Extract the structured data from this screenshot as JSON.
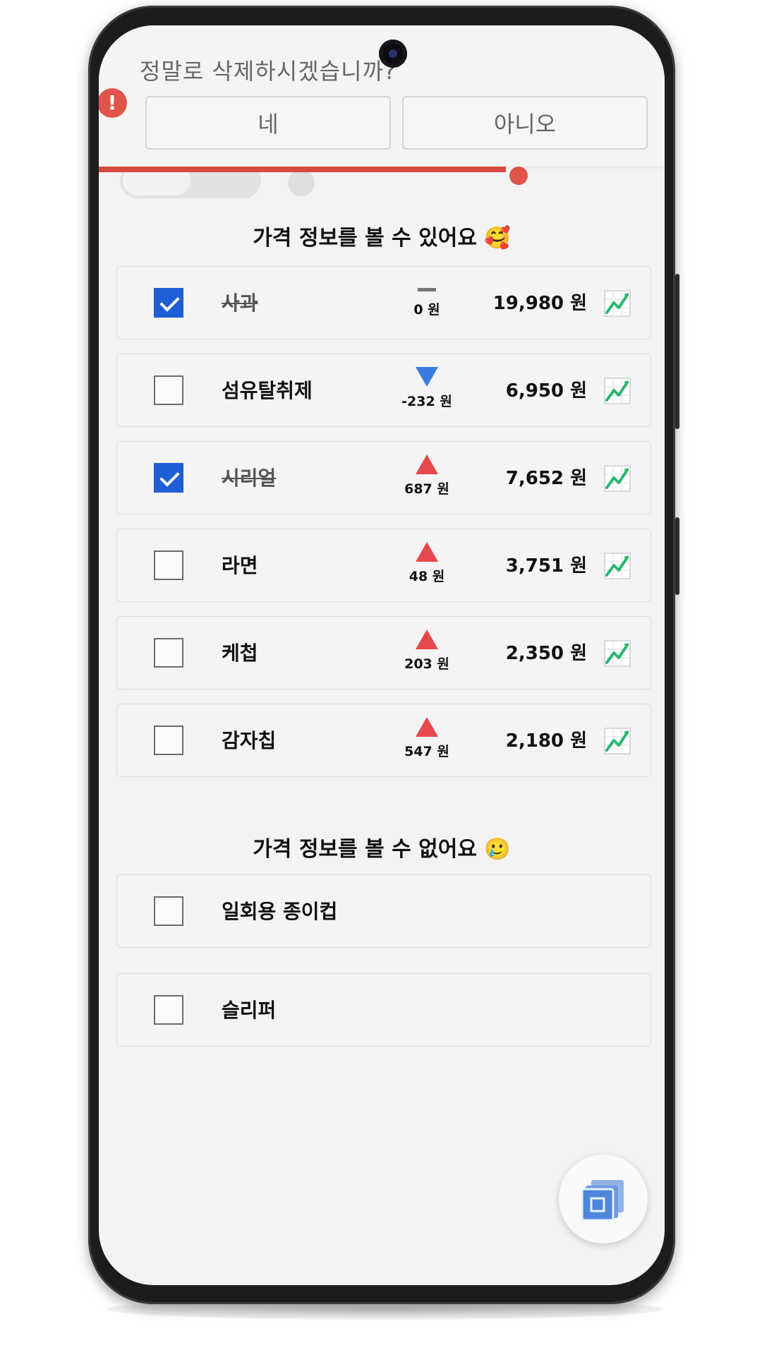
{
  "confirm": {
    "question": "정말로 삭제하시겠습니까?",
    "yes_label": "네",
    "no_label": "아니오",
    "alert_symbol": "!",
    "progress": 0.72
  },
  "sections": {
    "with_price_title": "가격 정보를 볼 수 있어요 🥰",
    "without_price_title": "가격 정보를 볼 수 없어요 🥲"
  },
  "items_with_price": [
    {
      "name": "사과",
      "checked": true,
      "trend": "flat",
      "delta": "0 원",
      "price": "19,980 원"
    },
    {
      "name": "섬유탈취제",
      "checked": false,
      "trend": "down",
      "delta": "-232 원",
      "price": "6,950 원"
    },
    {
      "name": "시리얼",
      "checked": true,
      "trend": "up",
      "delta": "687 원",
      "price": "7,652 원"
    },
    {
      "name": "라면",
      "checked": false,
      "trend": "up",
      "delta": "48 원",
      "price": "3,751 원"
    },
    {
      "name": "케첩",
      "checked": false,
      "trend": "up",
      "delta": "203 원",
      "price": "2,350 원"
    },
    {
      "name": "감자칩",
      "checked": false,
      "trend": "up",
      "delta": "547 원",
      "price": "2,180 원"
    }
  ],
  "items_without_price": [
    {
      "name": "일회용 종이컵",
      "checked": false
    },
    {
      "name": "슬리퍼",
      "checked": false
    }
  ],
  "colors": {
    "accent_blue": "#1f5fd6",
    "up_red": "#e5484d",
    "down_blue": "#3b7be0",
    "banner_red": "#d64a3e",
    "chart_green": "#2bb574"
  },
  "icons": {
    "trend_chart": "chart-increasing-icon",
    "fab": "layers-icon",
    "alert": "exclamation-icon"
  }
}
